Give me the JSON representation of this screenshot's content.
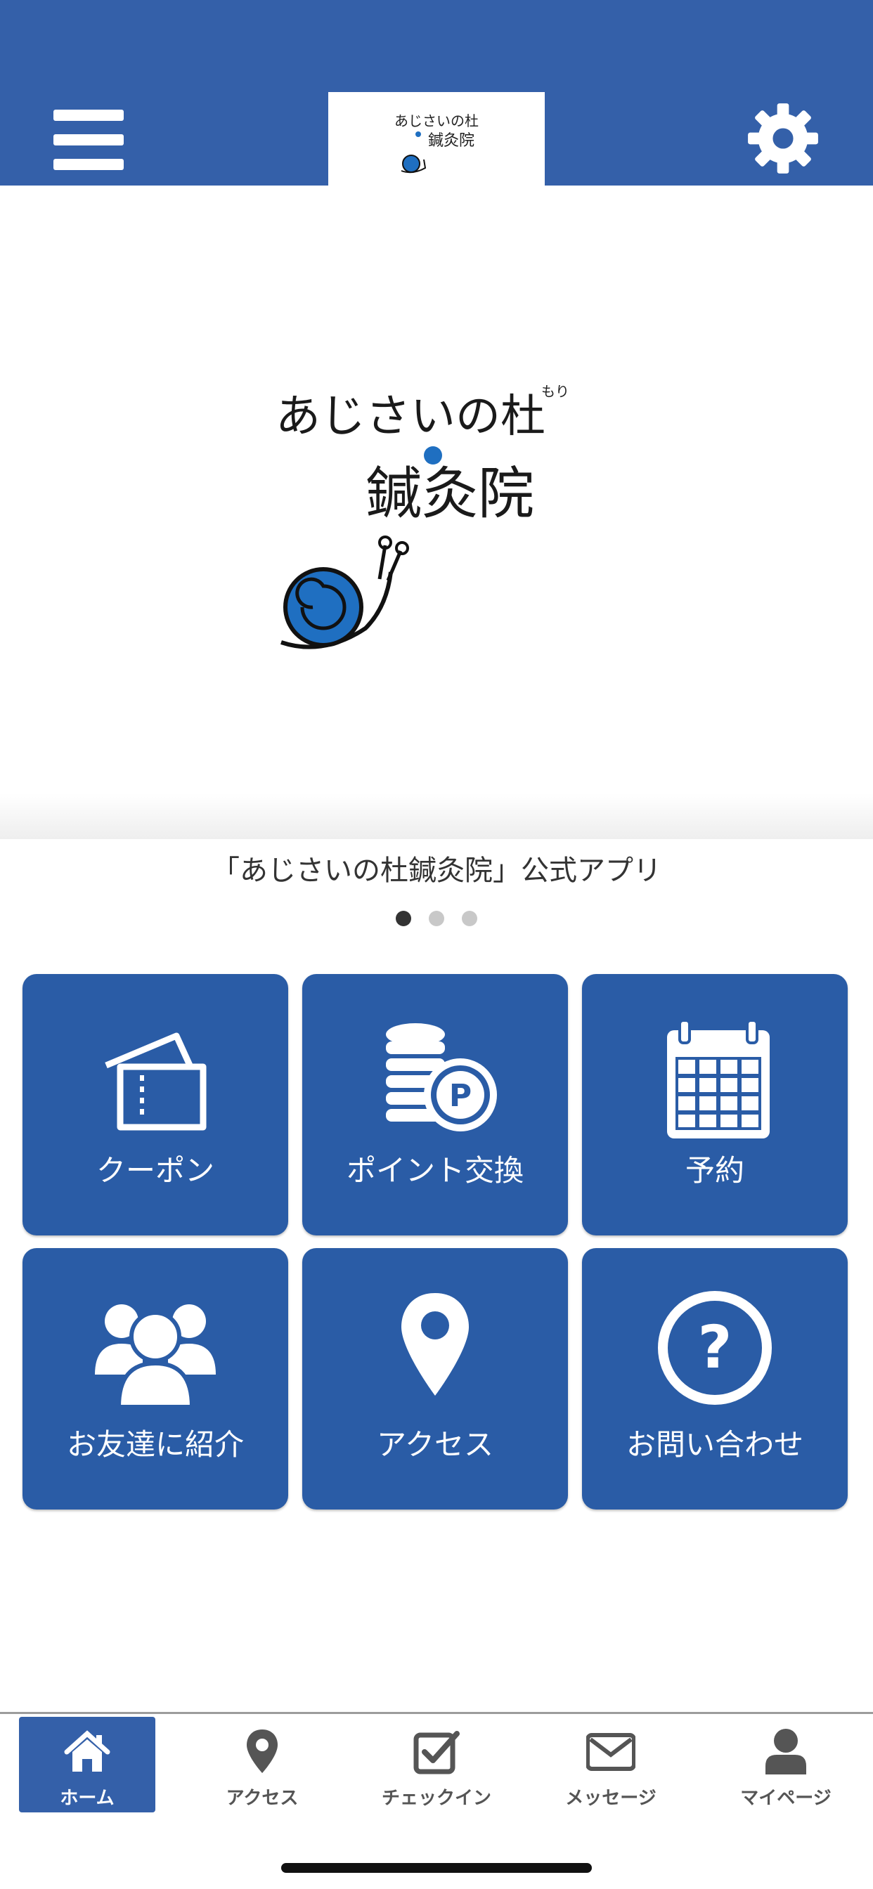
{
  "header": {
    "menu_icon": "hamburger-menu-icon",
    "logo_text": "あじさいの杜鍼灸院",
    "settings_icon": "gear-icon",
    "background": "#3460a9"
  },
  "hero": {
    "logo_line1": "あじさいの杜",
    "logo_ruby": "もり",
    "logo_line2": "鍼灸院",
    "caption": "「あじさいの杜鍼灸院」公式アプリ",
    "pager": {
      "count": 3,
      "active": 1
    }
  },
  "menu": {
    "tiles": [
      {
        "label": "クーポン",
        "icon": "ticket-icon"
      },
      {
        "label": "ポイント交換",
        "icon": "coin-stack-points-icon"
      },
      {
        "label": "予約",
        "icon": "calendar-icon"
      },
      {
        "label": "お友達に紹介",
        "icon": "group-users-icon"
      },
      {
        "label": "アクセス",
        "icon": "map-pin-icon"
      },
      {
        "label": "お問い合わせ",
        "icon": "question-circle-icon"
      }
    ],
    "tile_color": "#2a5ca6"
  },
  "tabbar": {
    "tabs": [
      {
        "label": "ホーム",
        "icon": "home-icon",
        "active": true
      },
      {
        "label": "アクセス",
        "icon": "map-pin-icon",
        "active": false
      },
      {
        "label": "チェックイン",
        "icon": "checkbox-icon",
        "active": false
      },
      {
        "label": "メッセージ",
        "icon": "envelope-icon",
        "active": false
      },
      {
        "label": "マイページ",
        "icon": "user-icon",
        "active": false
      }
    ],
    "active_color": "#3460a9"
  }
}
